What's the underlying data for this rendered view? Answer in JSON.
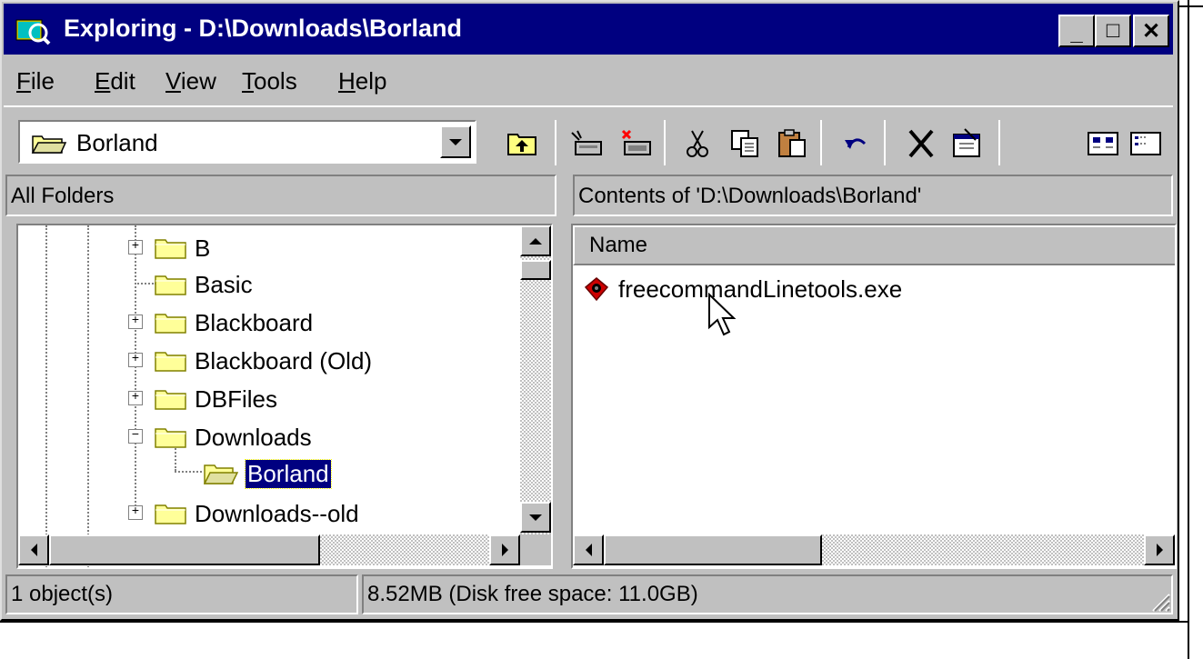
{
  "window": {
    "title": "Exploring - D:\\Downloads\\Borland",
    "minimize": "_",
    "maximize": "□",
    "close": "✕"
  },
  "menubar": [
    {
      "label": "File",
      "accel": "F",
      "rest": "ile"
    },
    {
      "label": "Edit",
      "accel": "E",
      "rest": "dit"
    },
    {
      "label": "View",
      "accel": "V",
      "rest": "iew"
    },
    {
      "label": "Tools",
      "accel": "T",
      "rest": "ools"
    },
    {
      "label": "Help",
      "accel": "H",
      "rest": "elp"
    }
  ],
  "toolbar": {
    "address_value": "Borland",
    "icons": [
      "up-folder-icon",
      "map-drive-icon",
      "disconnect-drive-icon",
      "cut-icon",
      "copy-icon",
      "paste-icon",
      "undo-icon",
      "delete-icon",
      "properties-icon",
      "large-icons-view-icon",
      "small-icons-view-icon"
    ]
  },
  "left_pane": {
    "header": "All Folders",
    "items": [
      {
        "label": "B",
        "expand": "+"
      },
      {
        "label": "Basic",
        "expand": ""
      },
      {
        "label": "Blackboard",
        "expand": "+"
      },
      {
        "label": "Blackboard (Old)",
        "expand": "+"
      },
      {
        "label": "DBFiles",
        "expand": "+"
      },
      {
        "label": "Downloads",
        "expand": "−"
      },
      {
        "label": "Borland",
        "expand": "",
        "selected": true
      },
      {
        "label": "Downloads--old",
        "expand": "+"
      }
    ]
  },
  "right_pane": {
    "header": "Contents of 'D:\\Downloads\\Borland'",
    "column_name": "Name",
    "files": [
      {
        "name": "freecommandLinetools.exe",
        "icon": "installer-exe-icon"
      }
    ]
  },
  "statusbar": {
    "objects": "1 object(s)",
    "size": "8.52MB (Disk free space: 11.0GB)"
  },
  "colors": {
    "title_bg": "#000080",
    "face": "#c0c0c0",
    "selection": "#000080"
  }
}
